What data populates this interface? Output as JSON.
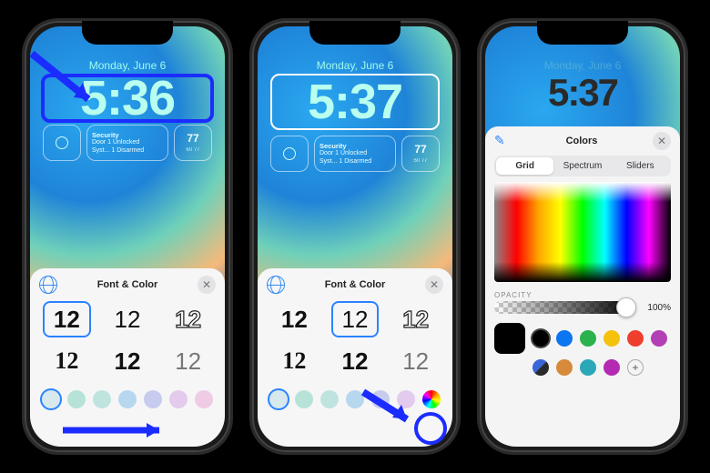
{
  "phone1": {
    "date": "Monday, June 6",
    "time": "5:36",
    "widgets": {
      "security": {
        "title": "Security",
        "line1": "Door   1 Unlocked",
        "line2": "Syst... 1 Disarmed"
      },
      "weather": {
        "temp": "77",
        "range": "60  77"
      }
    },
    "sheet_title": "Font & Color",
    "font_sample": "12",
    "colors": [
      "#d7e9ed",
      "#b7e2d8",
      "#bfe4df",
      "#b7d7ee",
      "#c7cbee",
      "#e3cbee",
      "#f0cbe4"
    ]
  },
  "phone2": {
    "date": "Monday, June 6",
    "time": "5:37",
    "widgets": {
      "security": {
        "title": "Security",
        "line1": "Door   1 Unlocked",
        "line2": "Syst... 1 Disarmed"
      },
      "weather": {
        "temp": "77",
        "range": "60  77"
      }
    },
    "sheet_title": "Font & Color",
    "font_sample": "12",
    "colors": [
      "#d7e9ed",
      "#b7e2d8",
      "#bfe4df",
      "#b7d7ee",
      "#c7cbee",
      "#e3cbee"
    ]
  },
  "phone3": {
    "date": "Monday, June 6",
    "time": "5:37",
    "colors_panel": {
      "title": "Colors",
      "tabs": [
        "Grid",
        "Spectrum",
        "Sliders"
      ],
      "opacity_label": "OPACITY",
      "opacity_value": "100%",
      "presets_row1": [
        "#000000",
        "#0b76ef",
        "#2bb24c",
        "#f4c20d",
        "#ef3e2e",
        "#b33fb5"
      ],
      "presets_row2": [
        "#3a66d6",
        "#d68a3a",
        "#2aa8b8",
        "#b52ab2"
      ]
    }
  }
}
